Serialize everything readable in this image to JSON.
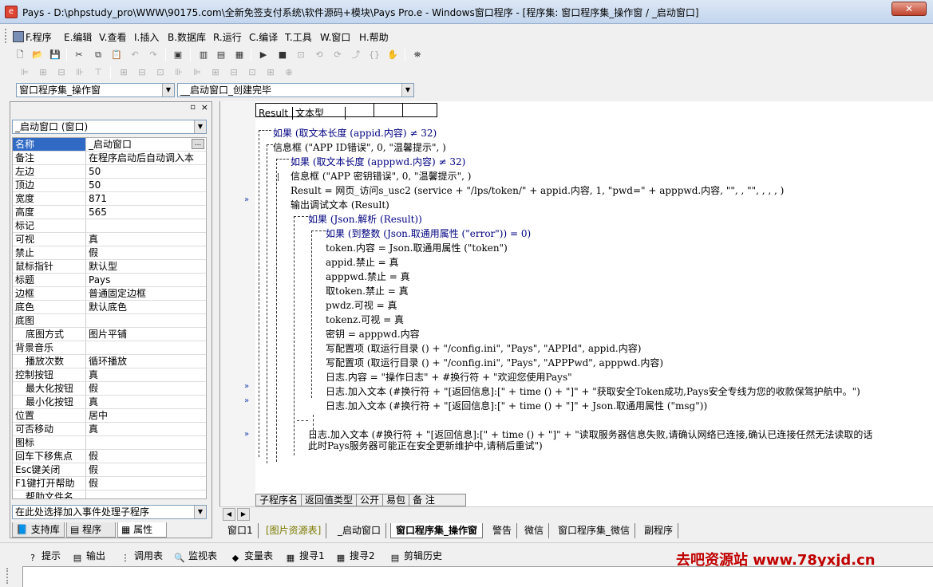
{
  "window": {
    "title": "Pays - D:\\phpstudy_pro\\WWW\\90175.com\\全新免签支付系统\\软件源码+模块\\Pays Pro.e - Windows窗口程序 - [程序集: 窗口程序集_操作窗 / _启动窗口]",
    "app_icon": "e",
    "close_label": "✕"
  },
  "menu": [
    "F.程序",
    "E.编辑",
    "V.查看",
    "I.插入",
    "B.数据库",
    "R.运行",
    "C.编译",
    "T.工具",
    "W.窗口",
    "H.帮助"
  ],
  "combos": {
    "assembly": "窗口程序集_操作窗",
    "subroutine": "__启动窗口_创建完毕",
    "object": "_启动窗口 (窗口)",
    "event": "在此处选择加入事件处理子程序"
  },
  "properties": [
    {
      "name": "名称",
      "value": "_启动窗口",
      "selected": true,
      "dots": "..."
    },
    {
      "name": "备注",
      "value": "在程序启动后自动调入本"
    },
    {
      "name": "左边",
      "value": "50"
    },
    {
      "name": "顶边",
      "value": "50"
    },
    {
      "name": "宽度",
      "value": "871"
    },
    {
      "name": "高度",
      "value": "565"
    },
    {
      "name": "标记",
      "value": ""
    },
    {
      "name": "可视",
      "value": "真"
    },
    {
      "name": "禁止",
      "value": "假"
    },
    {
      "name": "鼠标指针",
      "value": "默认型"
    },
    {
      "name": "标题",
      "value": "Pays"
    },
    {
      "name": "边框",
      "value": "普通固定边框"
    },
    {
      "name": "底色",
      "value": "默认底色"
    },
    {
      "name": "底图",
      "value": ""
    },
    {
      "name": "底图方式",
      "value": "图片平铺",
      "indent": true
    },
    {
      "name": "背景音乐",
      "value": ""
    },
    {
      "name": "播放次数",
      "value": "循环播放",
      "indent": true
    },
    {
      "name": "控制按钮",
      "value": "真"
    },
    {
      "name": "最大化按钮",
      "value": "假",
      "indent": true
    },
    {
      "name": "最小化按钮",
      "value": "真",
      "indent": true
    },
    {
      "name": "位置",
      "value": "居中"
    },
    {
      "name": "可否移动",
      "value": "真"
    },
    {
      "name": "图标",
      "value": ""
    },
    {
      "name": "回车下移焦点",
      "value": "假"
    },
    {
      "name": "Esc键关闭",
      "value": "假"
    },
    {
      "name": "F1键打开帮助",
      "value": "假"
    },
    {
      "name": "帮助文件名",
      "value": "",
      "indent": true
    }
  ],
  "left_tabs": [
    "支持库",
    "程序",
    "属性"
  ],
  "code_header": [
    "Result",
    "文本型",
    "",
    "",
    ""
  ],
  "code_lines": [
    {
      "text": "如果 (取文本长度 (appid.内容) ≠ 32)"
    },
    {
      "text": "信息框 (\"APP ID错误\", 0, \"温馨提示\", )"
    },
    {
      "text": "如果 (取文本长度 (apppwd.内容) ≠ 32)"
    },
    {
      "text": "信息框 (\"APP 密钥错误\", 0, \"温馨提示\", )"
    },
    {
      "text": "Result = 网页_访问s_usc2 (service + \"/lps/token/\" + appid.内容, 1, \"pwd=\" + apppwd.内容, \"\", , \"\", , , , )"
    },
    {
      "text": "输出调试文本 (Result)"
    },
    {
      "text": "如果 (Json.解析 (Result))"
    },
    {
      "text": "如果 (到整数 (Json.取通用属性 (\"error\")) = 0)"
    },
    {
      "text": "token.内容 = Json.取通用属性 (\"token\")"
    },
    {
      "text": "appid.禁止 = 真"
    },
    {
      "text": "apppwd.禁止 = 真"
    },
    {
      "text": "取token.禁止 = 真"
    },
    {
      "text": "pwdz.可视 = 真"
    },
    {
      "text": "tokenz.可视 = 真"
    },
    {
      "text": "密钥 = apppwd.内容"
    },
    {
      "text": "写配置项 (取运行目录 () + \"/config.ini\", \"Pays\", \"APPId\", appid.内容)"
    },
    {
      "text": "写配置项 (取运行目录 () + \"/config.ini\", \"Pays\", \"APPPwd\", apppwd.内容)"
    },
    {
      "text": "日志.内容 = \"操作日志\" + #换行符 + \"欢迎您使用Pays\""
    },
    {
      "text": "日志.加入文本 (#换行符 + \"[返回信息]:[\" + time () + \"]\" + \"获取安全Token成功,Pays安全专线为您的收款保驾护航中。\")"
    },
    {
      "text": "日志.加入文本 (#换行符 + \"[返回信息]:[\" + time () + \"]\" + Json.取通用属性 (\"msg\"))"
    },
    {
      "text": "日志.加入文本 (#换行符 + \"[返回信息]:[\" + time () + \"]\" + \"读取服务器信息失败,请确认网络已连接,确认已连接任然无法读取的话"
    },
    {
      "text": "此时Pays服务器可能正在安全更新维护中,请稍后重试\")"
    }
  ],
  "bottom_table": [
    "子程序名",
    "返回值类型",
    "公开",
    "易包",
    "备 注"
  ],
  "editor_tabs": [
    "窗口1",
    "[图片资源表]",
    "_启动窗口",
    "窗口程序集_操作窗",
    "警告",
    "微信",
    "窗口程序集_微信",
    "副程序"
  ],
  "bottom_items": [
    {
      "label": "提示",
      "icon": "?"
    },
    {
      "label": "输出",
      "icon": "▤"
    },
    {
      "label": "调用表",
      "icon": "⋮"
    },
    {
      "label": "监视表",
      "icon": "🔍"
    },
    {
      "label": "变量表",
      "icon": "◆"
    },
    {
      "label": "搜寻1",
      "icon": "▦"
    },
    {
      "label": "搜寻2",
      "icon": "▦"
    },
    {
      "label": "剪辑历史",
      "icon": "▤"
    }
  ],
  "watermark": "去吧资源站 www.78yxjd.cn",
  "markers": [
    "»",
    "»",
    "»",
    "»",
    "»"
  ]
}
